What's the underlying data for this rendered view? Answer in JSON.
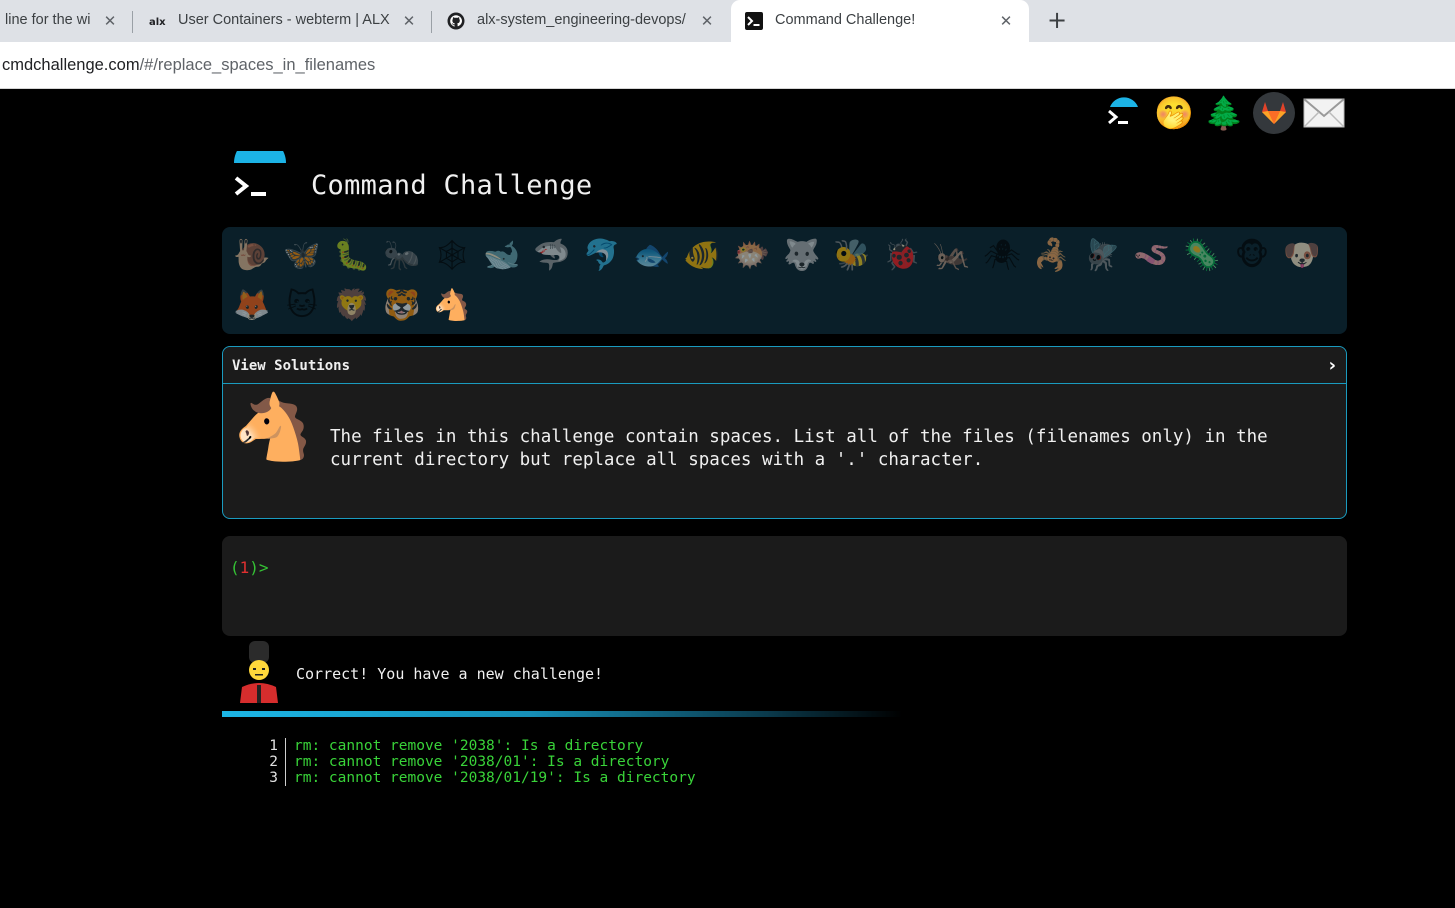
{
  "browser": {
    "tabs": [
      {
        "title": "line for the wi",
        "active": false
      },
      {
        "title": "User Containers - webterm | ALX",
        "favicon": "alx",
        "active": false
      },
      {
        "title": "alx-system_engineering-devops/",
        "active": false
      },
      {
        "title": "Command Challenge!",
        "active": true
      }
    ],
    "close_glyph": "✕",
    "new_tab_glyph": "+",
    "url_host": "cmdchallenge.com",
    "url_path": "/#/replace_spaces_in_filenames"
  },
  "header": {
    "top_icons": [
      {
        "name": "terminal-logo-icon",
        "glyph": ""
      },
      {
        "name": "hushed-face-icon",
        "glyph": "🤭"
      },
      {
        "name": "tree-icon",
        "glyph": "🌲"
      },
      {
        "name": "gitlab-icon",
        "glyph": "🦊"
      },
      {
        "name": "mail-icon",
        "glyph": "✉"
      }
    ],
    "title": "Command Challenge"
  },
  "challenges": [
    {
      "name": "snail",
      "glyph": "🐌"
    },
    {
      "name": "butterfly",
      "glyph": "🦋"
    },
    {
      "name": "caterpillar",
      "glyph": "🐛"
    },
    {
      "name": "ant",
      "glyph": "🐜"
    },
    {
      "name": "spider-web",
      "glyph": "🕸"
    },
    {
      "name": "whale",
      "glyph": "🐋"
    },
    {
      "name": "shark",
      "glyph": "🦈"
    },
    {
      "name": "dolphin",
      "glyph": "🐬"
    },
    {
      "name": "fish",
      "glyph": "🐟"
    },
    {
      "name": "tropical-fish",
      "glyph": "🐠"
    },
    {
      "name": "blowfish",
      "glyph": "🐡"
    },
    {
      "name": "wolf",
      "glyph": "🐺"
    },
    {
      "name": "bee",
      "glyph": "🐝"
    },
    {
      "name": "ladybug",
      "glyph": "🐞"
    },
    {
      "name": "cricket",
      "glyph": "🦗"
    },
    {
      "name": "spider",
      "glyph": "🕷"
    },
    {
      "name": "scorpion",
      "glyph": "🦂"
    },
    {
      "name": "fly",
      "glyph": "🪰"
    },
    {
      "name": "worm",
      "glyph": "🪱"
    },
    {
      "name": "microbe",
      "glyph": "🦠"
    },
    {
      "name": "monkey",
      "glyph": "🐵"
    },
    {
      "name": "dog",
      "glyph": "🐶"
    },
    {
      "name": "fox",
      "glyph": "🦊"
    },
    {
      "name": "cat",
      "glyph": "🐱"
    },
    {
      "name": "lion",
      "glyph": "🦁"
    },
    {
      "name": "tiger",
      "glyph": "🐯"
    },
    {
      "name": "horse",
      "glyph": "🐴",
      "current": true
    }
  ],
  "solutions": {
    "label": "View Solutions",
    "chevron": "›",
    "challenge_glyph": "🐴",
    "description": "The files in this challenge contain spaces. List all of the files (filenames only) in the current directory but replace all spaces with a '.' character."
  },
  "terminal": {
    "prompt_open": "(",
    "prompt_number": "1",
    "prompt_close": ")>"
  },
  "result": {
    "message": "Correct! You have a new challenge!"
  },
  "output_lines": [
    {
      "num": "1",
      "text": "rm: cannot remove '2038': Is a directory"
    },
    {
      "num": "2",
      "text": "rm: cannot remove '2038/01': Is a directory"
    },
    {
      "num": "3",
      "text": "rm: cannot remove '2038/01/19': Is a directory"
    }
  ],
  "colors": {
    "accent": "#1a9bbf",
    "prompt_green": "#35c335",
    "prompt_red": "#e03030",
    "output_green": "#39d339"
  }
}
